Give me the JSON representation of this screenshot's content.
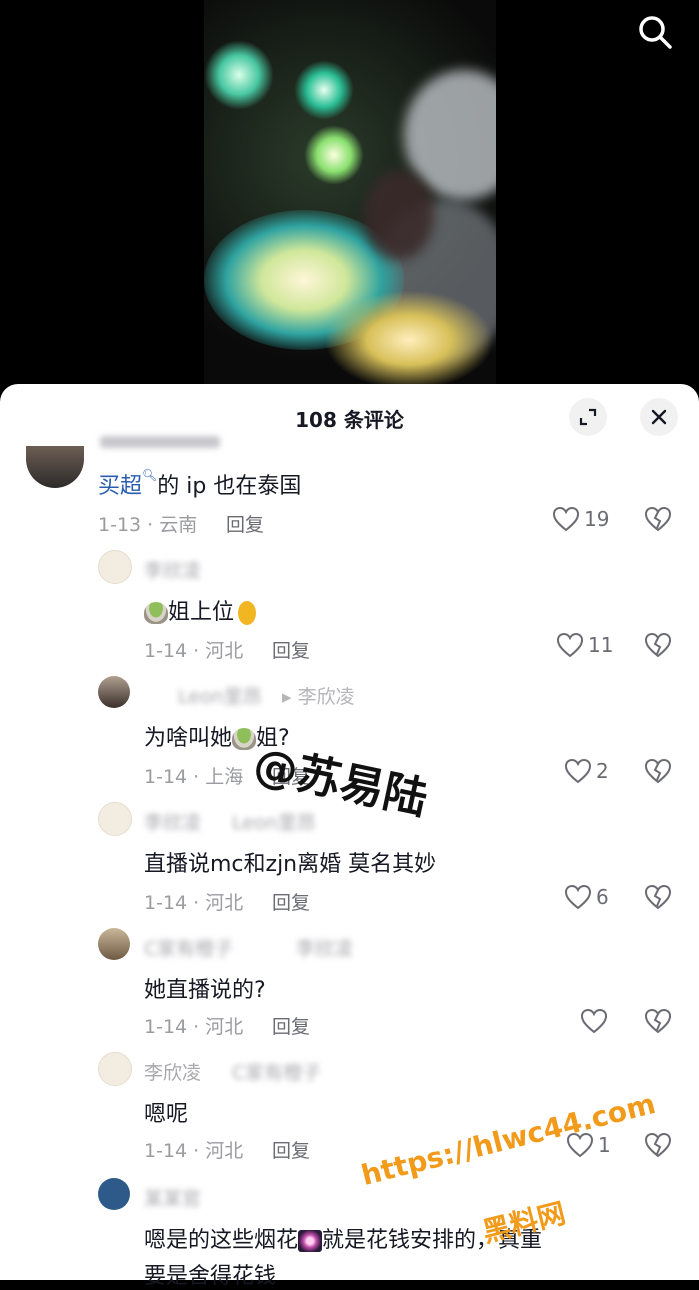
{
  "header": {
    "search_icon": "search-icon"
  },
  "sheet": {
    "title": "108 条评论",
    "expand_icon": "expand-icon",
    "close_icon": "close-icon"
  },
  "comments": [
    {
      "name": "",
      "text_link": "买超",
      "text": "的 ip 也在泰国",
      "meta": "1-13 · 云南",
      "reply": "回复",
      "likes": "19"
    },
    {
      "name": "李欣凌",
      "text": "姐上位",
      "meta": "1-14 · 河北",
      "reply": "回复",
      "likes": "11"
    },
    {
      "name": "Leon里昂",
      "reply_to": "李欣凌",
      "text_a": "为啥叫她",
      "text_b": "姐?",
      "meta": "1-14 · 上海",
      "reply": "回复",
      "likes": "2"
    },
    {
      "name": "李欣凌",
      "reply_to": "Leon里昂",
      "text": "直播说mc和zjn离婚 莫名其妙",
      "meta": "1-14 · 河北",
      "reply": "回复",
      "likes": "6"
    },
    {
      "name": "C家有橙子",
      "reply_to": "李欣凌",
      "text": "她直播说的?",
      "meta": "1-14 · 河北",
      "reply": "回复",
      "likes": ""
    },
    {
      "name": "李欣凌",
      "reply_to": "C家有橙子",
      "text": "嗯呢",
      "meta": "1-14 · 河北",
      "reply": "回复",
      "likes": "1"
    },
    {
      "name": "某某官",
      "text_a": "嗯是的这些烟花",
      "text_b": "就是花钱安排的",
      "text_c": "，真重",
      "text_line2": "要是舍得花钱"
    }
  ],
  "watermarks": {
    "handle": "@苏易陆",
    "url": "https://hlwc44.com",
    "site": "黑料网"
  },
  "colors": {
    "link": "#2a5db0",
    "muted": "#9b9ca1",
    "accent": "#f29a1a"
  }
}
